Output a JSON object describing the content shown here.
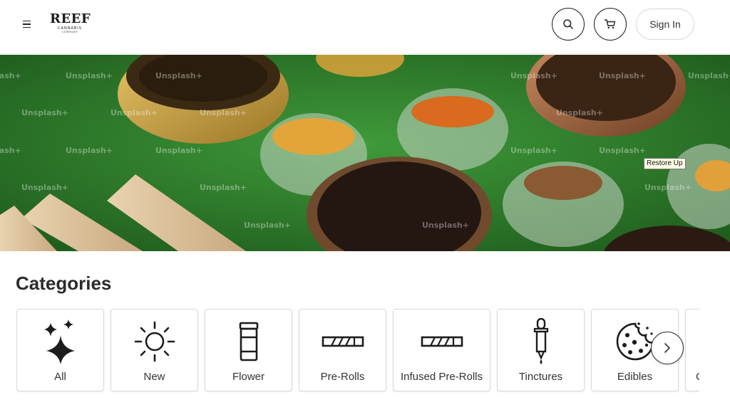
{
  "header": {
    "logo_main": "REEF",
    "logo_sub": "CANNABIS",
    "logo_sub2": "COMPANY",
    "sign_in_label": "Sign In",
    "icons": [
      "menu-icon",
      "search-icon",
      "cart-icon"
    ]
  },
  "hero": {
    "watermark": "Unsplash+",
    "tooltip": "Restore Up"
  },
  "categories": {
    "title": "Categories",
    "items": [
      {
        "label": "All",
        "icon": "sparkles-icon"
      },
      {
        "label": "New",
        "icon": "sun-icon"
      },
      {
        "label": "Flower",
        "icon": "jar-icon"
      },
      {
        "label": "Pre-Rolls",
        "icon": "pre-roll-icon"
      },
      {
        "label": "Infused Pre-Rolls",
        "icon": "infused-pre-roll-icon"
      },
      {
        "label": "Tinctures",
        "icon": "dropper-icon"
      },
      {
        "label": "Edibles",
        "icon": "cookie-icon"
      },
      {
        "label": "C",
        "icon": "partial-icon"
      }
    ],
    "next_icon": "chevron-right-icon"
  },
  "colors": {
    "hero_green": "#2f7a2c",
    "text_dark": "#2b2b2b",
    "border": "#d9d9d9"
  }
}
